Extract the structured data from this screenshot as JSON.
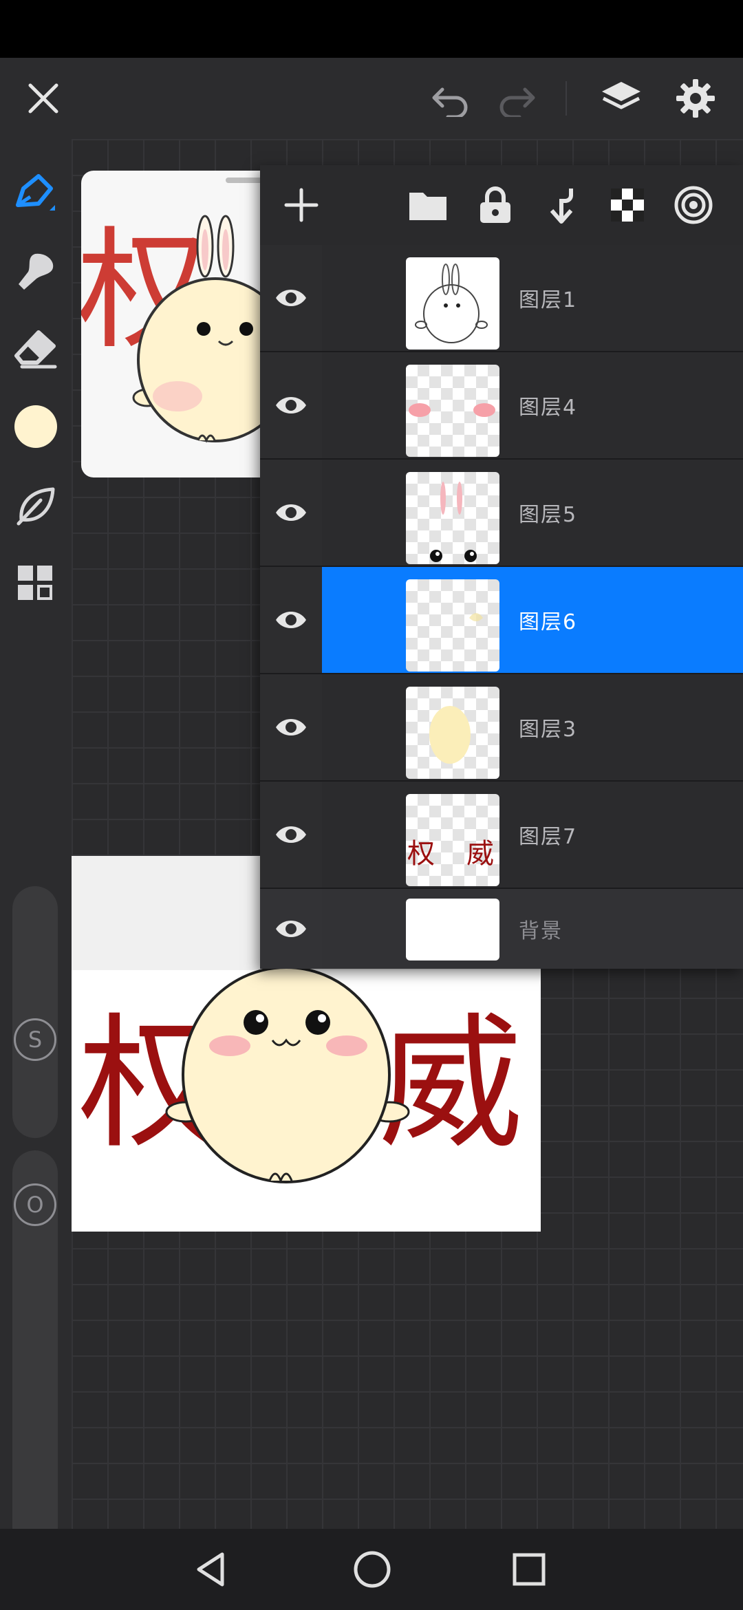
{
  "app": {
    "toolbar": {
      "close_icon": "close-icon",
      "undo_icon": "undo-icon",
      "redo_icon": "redo-icon",
      "layers_icon": "layers-icon",
      "settings_icon": "gear-icon"
    },
    "tools": [
      {
        "name": "brush",
        "icon": "pen-icon"
      },
      {
        "name": "smudge",
        "icon": "smudge-icon"
      },
      {
        "name": "eraser",
        "icon": "eraser-icon"
      },
      {
        "name": "color",
        "icon": "color-swatch",
        "color": "#fff3cf"
      },
      {
        "name": "select",
        "icon": "leaf-icon"
      },
      {
        "name": "menu",
        "icon": "grid-icon"
      }
    ],
    "sliders": {
      "size_label": "S",
      "opacity_label": "O"
    },
    "accent_color": "#0a7cff"
  },
  "artwork": {
    "char_left": "权",
    "char_right": "威",
    "text_color": "#9b1010"
  },
  "layers_panel": {
    "toolbar_icons": [
      "add-icon",
      "folder-icon",
      "lock-icon",
      "merge-down-icon",
      "checker-icon",
      "blend-mode-icon"
    ],
    "layers": [
      {
        "name": "图层1",
        "thumb": "outline",
        "selected": false
      },
      {
        "name": "图层4",
        "thumb": "cheeks",
        "selected": false
      },
      {
        "name": "图层5",
        "thumb": "ears-eyes",
        "selected": false
      },
      {
        "name": "图层6",
        "thumb": "faint",
        "selected": true
      },
      {
        "name": "图层3",
        "thumb": "body",
        "selected": false
      },
      {
        "name": "图层7",
        "thumb": "text",
        "selected": false
      },
      {
        "name": "背景",
        "thumb": "white",
        "selected": false
      }
    ],
    "thumb_text_left": "权",
    "thumb_text_right": "威"
  },
  "navbar": {
    "back_icon": "back-triangle-icon",
    "home_icon": "home-circle-icon",
    "recents_icon": "recents-square-icon"
  }
}
